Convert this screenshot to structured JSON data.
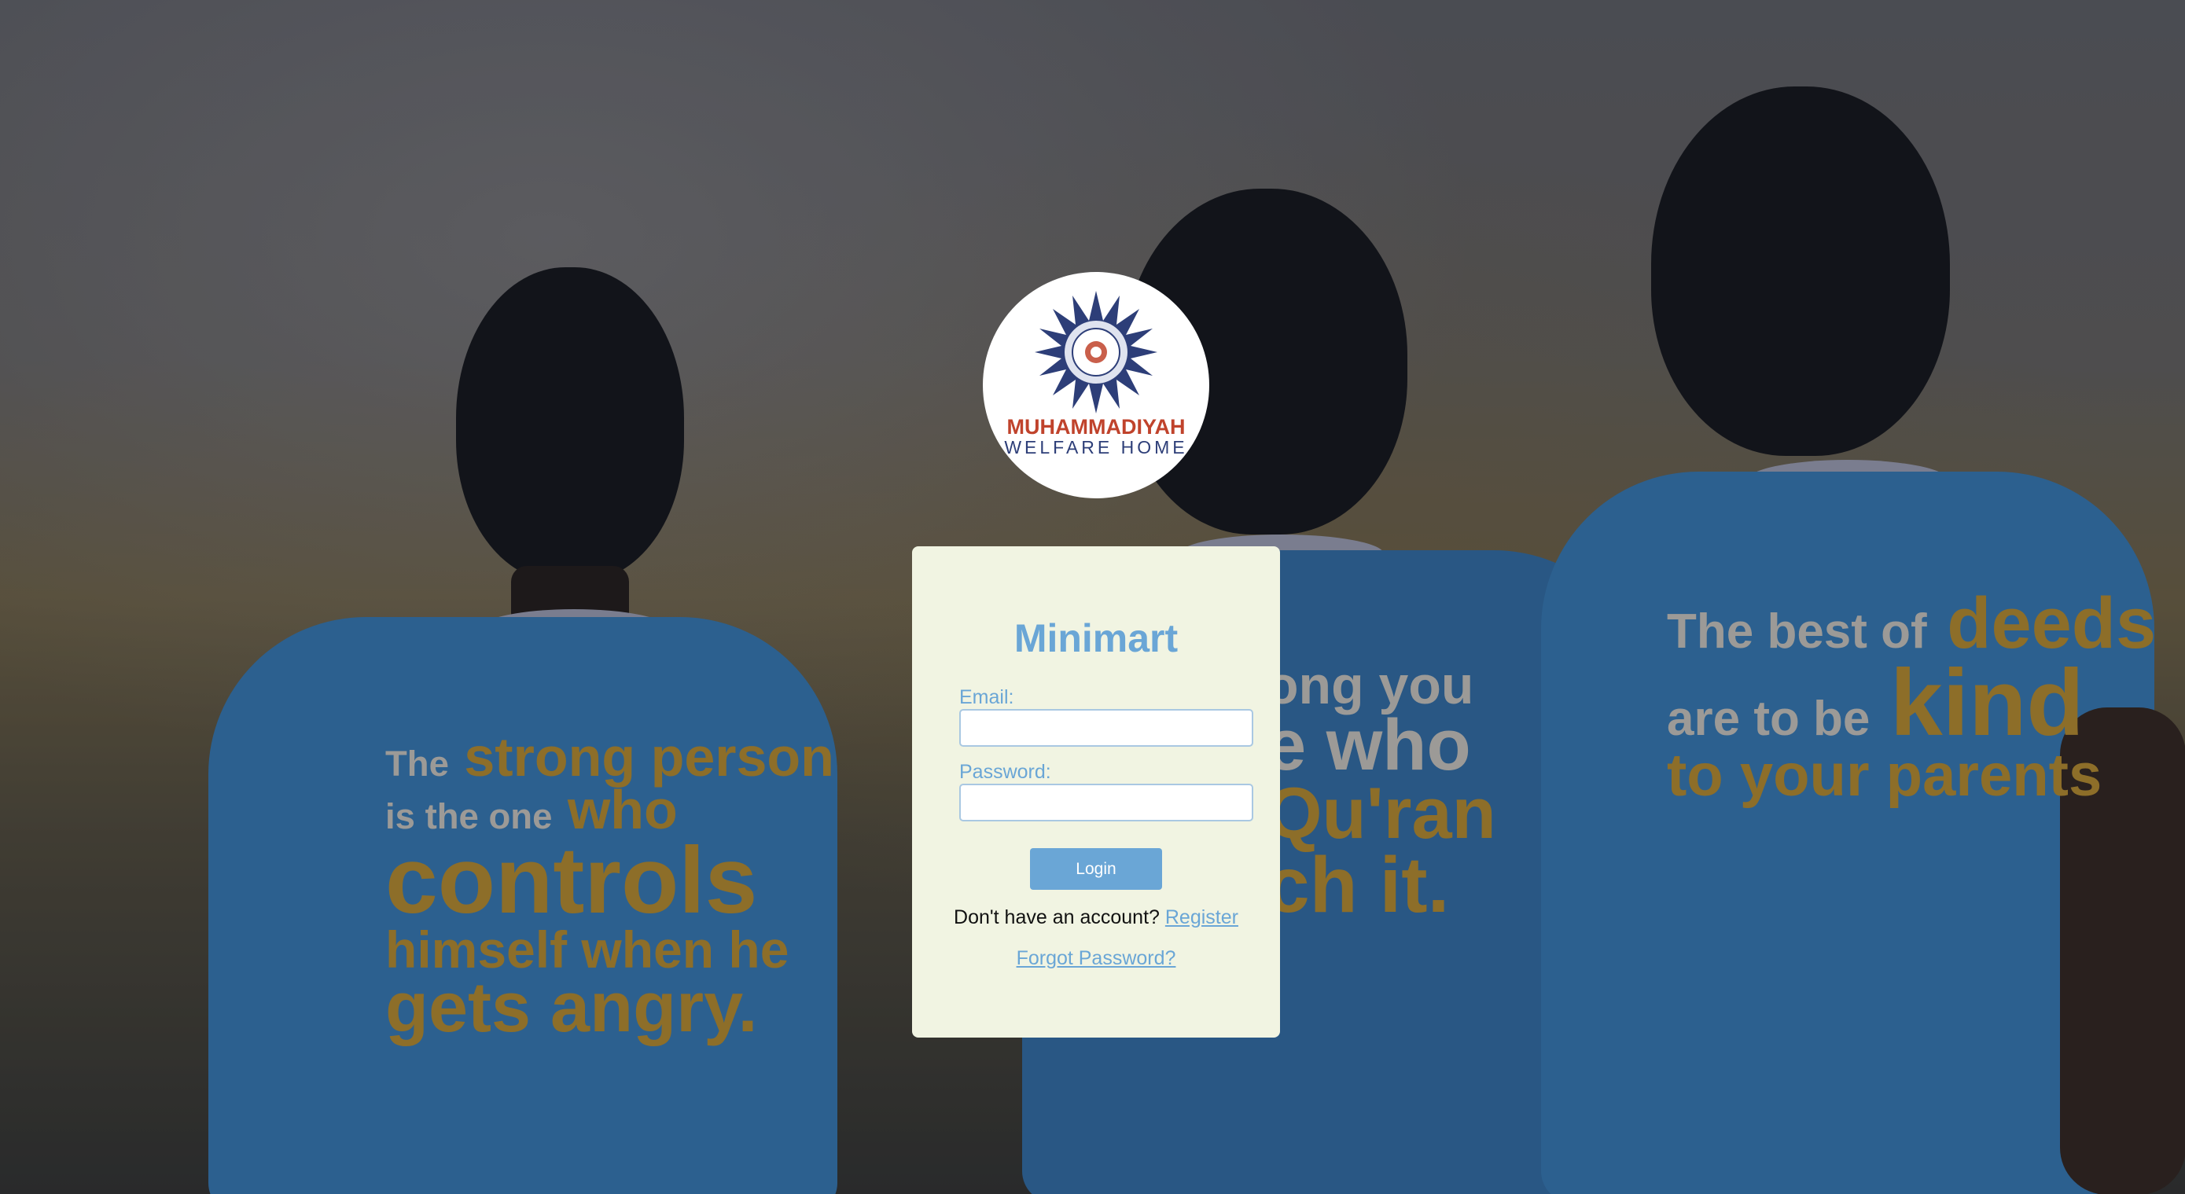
{
  "logo": {
    "line1": "MUHAMMADIYAH",
    "line2": "WELFARE HOME"
  },
  "login": {
    "title": "Minimart",
    "email_label": "Email:",
    "email_value": "",
    "password_label": "Password:",
    "password_value": "",
    "login_button": "Login",
    "no_account_text": "Don't have an account?",
    "register_link": "Register",
    "forgot_link": "Forgot Password?"
  },
  "background": {
    "shirt_texts": {
      "left": [
        "The",
        "strong person",
        "is the one",
        "who",
        "controls",
        "himself when he",
        "gets angry."
      ],
      "middle": [
        "ong you",
        "e who",
        "Qu'ran",
        "ch it."
      ],
      "right": [
        "The best of",
        "deeds",
        "are to be",
        "kind",
        "to your",
        "parents"
      ]
    }
  },
  "colors": {
    "accent": "#6aa6d6",
    "card_bg": "#f1f4e2",
    "logo_red": "#c0432c",
    "logo_blue": "#2d3e78"
  }
}
